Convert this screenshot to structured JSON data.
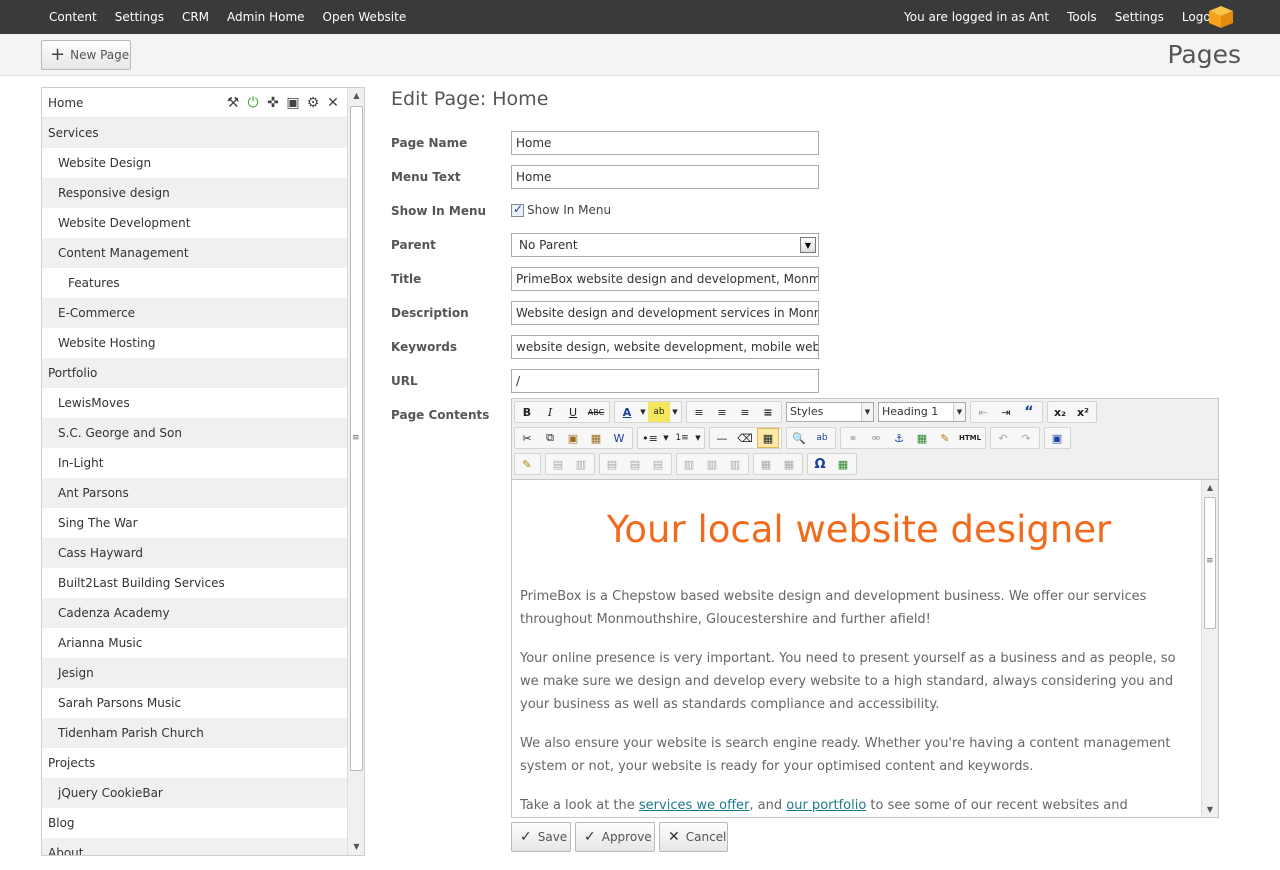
{
  "topbar": {
    "nav_left": [
      "Content",
      "Settings",
      "CRM",
      "Admin Home",
      "Open Website"
    ],
    "logged_in": "You are logged in as Ant",
    "nav_right": [
      "Tools",
      "Settings",
      "Logout"
    ],
    "logo_color": "#f7a21b"
  },
  "subbar": {
    "new_page_label": "New Page",
    "heading": "Pages"
  },
  "tree": {
    "items": [
      {
        "label": "Home",
        "level": 0
      },
      {
        "label": "Services",
        "level": 0
      },
      {
        "label": "Website Design",
        "level": 1
      },
      {
        "label": "Responsive design",
        "level": 1
      },
      {
        "label": "Website Development",
        "level": 1
      },
      {
        "label": "Content Management",
        "level": 1
      },
      {
        "label": "Features",
        "level": 2
      },
      {
        "label": "E-Commerce",
        "level": 1
      },
      {
        "label": "Website Hosting",
        "level": 1
      },
      {
        "label": "Portfolio",
        "level": 0
      },
      {
        "label": "LewisMoves",
        "level": 1
      },
      {
        "label": "S.C. George and Son",
        "level": 1
      },
      {
        "label": "In-Light",
        "level": 1
      },
      {
        "label": "Ant Parsons",
        "level": 1
      },
      {
        "label": "Sing The War",
        "level": 1
      },
      {
        "label": "Cass Hayward",
        "level": 1
      },
      {
        "label": "Built2Last Building Services",
        "level": 1
      },
      {
        "label": "Cadenza Academy",
        "level": 1
      },
      {
        "label": "Arianna Music",
        "level": 1
      },
      {
        "label": "Jesign",
        "level": 1
      },
      {
        "label": "Sarah Parsons Music",
        "level": 1
      },
      {
        "label": "Tidenham Parish Church",
        "level": 1
      },
      {
        "label": "Projects",
        "level": 0
      },
      {
        "label": "jQuery CookieBar",
        "level": 1
      },
      {
        "label": "Blog",
        "level": 0
      },
      {
        "label": "About",
        "level": 0
      }
    ],
    "tools": [
      "wrench-icon",
      "power-icon",
      "move-icon",
      "image-icon",
      "gear-icon",
      "close-icon"
    ]
  },
  "form": {
    "title": "Edit Page: Home",
    "page_name_label": "Page Name",
    "page_name_value": "Home",
    "menu_text_label": "Menu Text",
    "menu_text_value": "Home",
    "show_in_menu_label": "Show In Menu",
    "show_in_menu_checkbox_label": "Show In Menu",
    "parent_label": "Parent",
    "parent_value": "No Parent",
    "title_label": "Title",
    "title_value": "PrimeBox website design and development, Monmou",
    "description_label": "Description",
    "description_value": "Website design and development services in Monmo",
    "keywords_label": "Keywords",
    "keywords_value": "website design, website development, mobile websit",
    "url_label": "URL",
    "url_value": "/",
    "contents_label": "Page Contents"
  },
  "editor": {
    "styles_select": "Styles",
    "format_select": "Heading 1",
    "heading": "Your local website designer",
    "p1": "PrimeBox is a Chepstow based website design and development business. We offer our services throughout Monmouthshire, Gloucestershire and further afield!",
    "p2": "Your online presence is very important. You need to present yourself as a business and as people, so we make sure we design and develop every website to a high standard, always considering you and your business as well as standards compliance and accessibility.",
    "p3": "We also ensure your website is search engine ready. Whether you're having a content management system or not, your website is ready for your optimised content and keywords.",
    "p4_start": "Take a look at the ",
    "p4_link1": "services we offer",
    "p4_mid": ", and ",
    "p4_link2": "our portfolio",
    "p4_end": " to see some of our recent websites and",
    "heading_color": "#f26b1d",
    "link_color": "#1e7a8c"
  },
  "actions": {
    "save": "Save",
    "approve": "Approve",
    "cancel": "Cancel"
  }
}
